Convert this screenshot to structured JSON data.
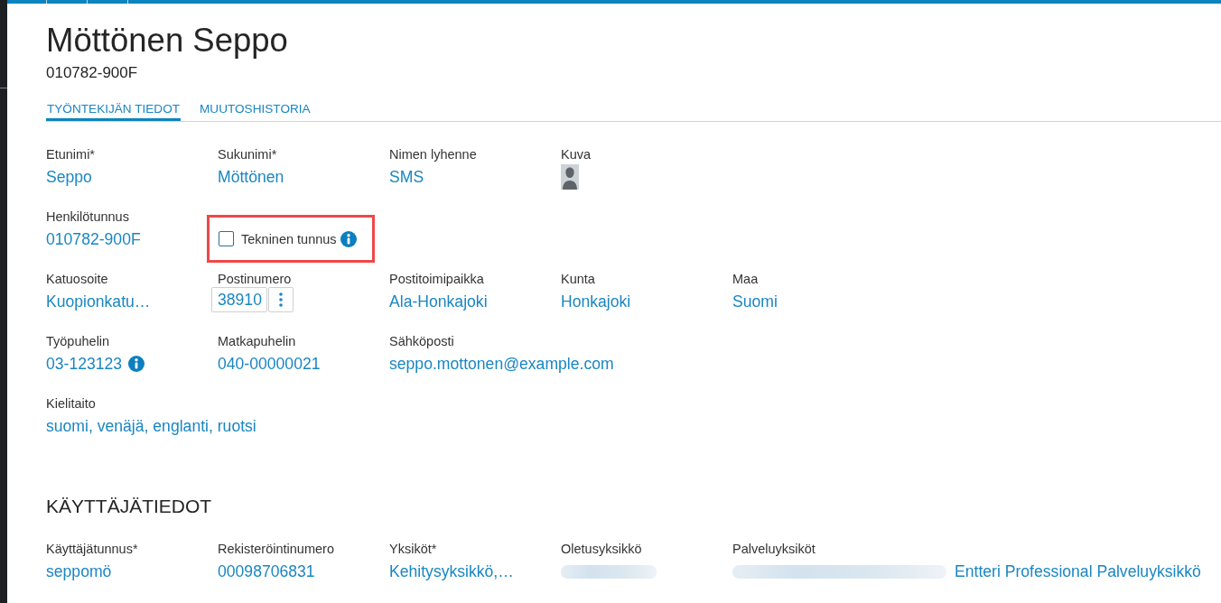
{
  "header": {
    "name": "Möttönen Seppo",
    "id_code": "010782-900F"
  },
  "tabs": [
    {
      "label": "TYÖNTEKIJÄN TIEDOT",
      "selected": true
    },
    {
      "label": "MUUTOSHISTORIA",
      "selected": false
    }
  ],
  "employee_details": {
    "rows": [
      {
        "fields": [
          {
            "kind": "text",
            "label": "Etunimi*",
            "value": "Seppo",
            "info": false,
            "blurred": false
          },
          {
            "kind": "text",
            "label": "Sukunimi*",
            "value": "Möttönen",
            "info": false,
            "blurred": false
          },
          {
            "kind": "text",
            "label": "Nimen lyhenne",
            "value": "SMS",
            "info": false,
            "blurred": false
          },
          {
            "kind": "photo",
            "label": "Kuva"
          }
        ]
      },
      {
        "fields": [
          {
            "kind": "text",
            "label": "Henkilötunnus",
            "value": "010782-900F",
            "info": false,
            "blurred": false
          },
          {
            "kind": "checkbox",
            "label": "Tekninen tunnus",
            "checked": false,
            "info": true,
            "highlighted": true
          }
        ]
      },
      {
        "fields": [
          {
            "kind": "text",
            "label": "Katuosoite",
            "value": "Kuopionkatu…",
            "info": false,
            "blurred": false
          },
          {
            "kind": "input",
            "label": "Postinumero",
            "value": "38910"
          },
          {
            "kind": "text",
            "label": "Postitoimipaikka",
            "value": "Ala-Honkajoki",
            "info": false,
            "blurred": false
          },
          {
            "kind": "text",
            "label": "Kunta",
            "value": "Honkajoki",
            "info": false,
            "blurred": false
          },
          {
            "kind": "text",
            "label": "Maa",
            "value": "Suomi",
            "info": false,
            "blurred": false
          }
        ]
      },
      {
        "fields": [
          {
            "kind": "text",
            "label": "Työpuhelin",
            "value": "03-123123",
            "info": true,
            "blurred": false
          },
          {
            "kind": "text",
            "label": "Matkapuhelin",
            "value": "040-00000021",
            "info": false,
            "blurred": false
          },
          {
            "kind": "text",
            "label": "Sähköposti",
            "value": "seppo.mottonen@example.com",
            "info": false,
            "blurred": false
          }
        ]
      },
      {
        "fields": [
          {
            "kind": "text",
            "label": "Kielitaito",
            "value": "suomi, venäjä, englanti, ruotsi",
            "info": false,
            "blurred": false
          }
        ]
      }
    ]
  },
  "user_section": {
    "title": "KÄYTTÄJÄTIEDOT",
    "rows": [
      {
        "fields": [
          {
            "kind": "text",
            "label": "Käyttäjätunnus*",
            "value": "seppomö",
            "info": false,
            "blurred": false
          },
          {
            "kind": "text",
            "label": "Rekisteröintinumero",
            "value": "00098706831",
            "info": false,
            "blurred": false
          },
          {
            "kind": "text",
            "label": "Yksiköt*",
            "value": "Kehitysyksikkö,…",
            "info": false,
            "blurred": false
          },
          {
            "kind": "text",
            "label": "Oletusyksikkö",
            "info": false,
            "blurred": true
          },
          {
            "kind": "text",
            "label": "Palveluyksiköt",
            "value": "Entteri Professional Palveluyksikkö",
            "info": false,
            "blurred": true
          }
        ]
      }
    ]
  }
}
